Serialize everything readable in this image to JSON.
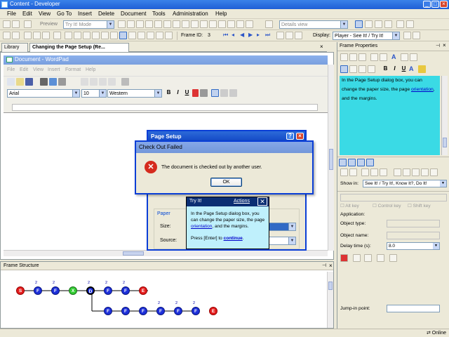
{
  "window": {
    "title": "Content - Developer"
  },
  "menu": [
    "File",
    "Edit",
    "View",
    "Go To",
    "Insert",
    "Delete",
    "Document",
    "Tools",
    "Administration",
    "Help"
  ],
  "toolbar1": {
    "preview_label": "Preview",
    "mode_value": "Try It! Mode",
    "view_value": "Details view"
  },
  "toolbar2": {
    "frame_id_label": "Frame ID:",
    "frame_id_value": "3",
    "display_label": "Display:",
    "display_value": "Player - See It! / Try It!"
  },
  "tabs": [
    {
      "label": "Library"
    },
    {
      "label": "Changing the Page Setup (Re..."
    }
  ],
  "wordpad": {
    "title": "Document - WordPad",
    "menu": [
      "File",
      "Edit",
      "View",
      "Insert",
      "Format",
      "Help"
    ],
    "font": "Arial",
    "size": "10",
    "script": "Western"
  },
  "page_setup": {
    "title": "Page Setup",
    "paper_group": "Paper",
    "size_label": "Size:",
    "source_label": "Source:"
  },
  "error_dialog": {
    "title": "Check Out Failed",
    "message": "The document is checked out by another user.",
    "ok_label": "OK"
  },
  "tryit": {
    "title": "Try It!",
    "actions_label": "Actions",
    "text_before": "In the Page Setup dialog box, you can change the paper size, the page ",
    "text_link": "orientation",
    "text_after": ", and the margins.",
    "press_before": "Press [Enter] to ",
    "press_link": "continue",
    "press_after": "."
  },
  "frame_structure": {
    "title": "Frame Structure",
    "row1": [
      {
        "label": "S",
        "color": "red"
      },
      {
        "label": "F",
        "color": "blue",
        "sup": "2"
      },
      {
        "label": "F",
        "color": "blue",
        "sup": "2"
      },
      {
        "label": "X",
        "color": "green"
      },
      {
        "label": "D",
        "color": "selected",
        "sup": "2"
      },
      {
        "label": "F",
        "color": "blue",
        "sup": "2"
      },
      {
        "label": "F",
        "color": "blue",
        "sup": "2"
      },
      {
        "label": "E",
        "color": "red"
      }
    ],
    "row2": [
      {
        "label": "F",
        "color": "blue"
      },
      {
        "label": "F",
        "color": "blue"
      },
      {
        "label": "F",
        "color": "blue"
      },
      {
        "label": "F",
        "color": "blue",
        "sup": "2"
      },
      {
        "label": "F",
        "color": "blue",
        "sup": "2"
      },
      {
        "label": "F",
        "color": "blue",
        "sup": "2"
      },
      {
        "label": "E",
        "color": "red"
      }
    ]
  },
  "frame_properties": {
    "title": "Frame Properties",
    "text": "In the Page Setup dialog box, you can change the paper size, the page orientation, and the margins.",
    "text_before": "In the Page Setup dialog box, you can change the paper size, the page ",
    "text_link": "orientation",
    "text_after": ", and the margins.",
    "show_in_label": "Show in:",
    "show_in_value": "See It! / Try It!, Know It?, Do It!",
    "alt_key": "Alt key",
    "control_key": "Control key",
    "shift_key": "Shift key",
    "application_label": "Application:",
    "object_type_label": "Object type:",
    "object_name_label": "Object name:",
    "delay_label": "Delay time (s):",
    "delay_value": "8.0",
    "jump_label": "Jump-in point:"
  },
  "status": {
    "online": "Online"
  }
}
